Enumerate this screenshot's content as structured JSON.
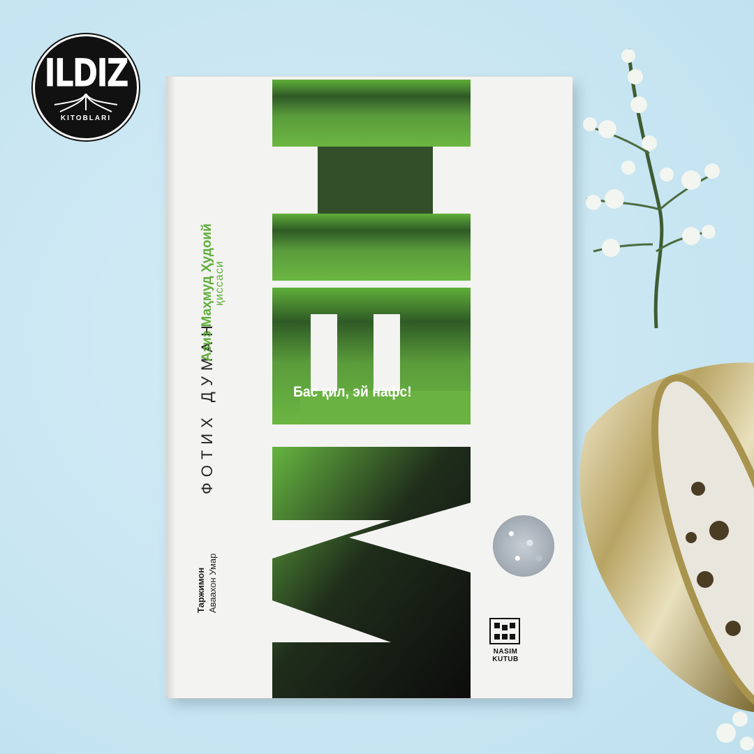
{
  "logo": {
    "word": "ILDIZ",
    "sub": "KITOBLARI"
  },
  "book": {
    "title": "МЕН",
    "author": "ФОТИХ ДУМАН",
    "subtitle_line1": "Азиз Маҳмуд Ҳудоий",
    "subtitle_line2": "қиссаси",
    "tagline": "Бас қил, эй нафс!",
    "translator_label": "Таржимон",
    "translator_name": "Аваахон Умар",
    "publisher": "NASIM KUTUB"
  },
  "colors": {
    "background": "#c9e6f2",
    "green": "#5fae39",
    "cover": "#f3f3f1",
    "letters": "#111111"
  },
  "icons": [
    "ildiz-logo",
    "publisher-logo-icon",
    "holographic-sticker-icon",
    "plant-sprig-icon",
    "gold-pot-icon"
  ]
}
